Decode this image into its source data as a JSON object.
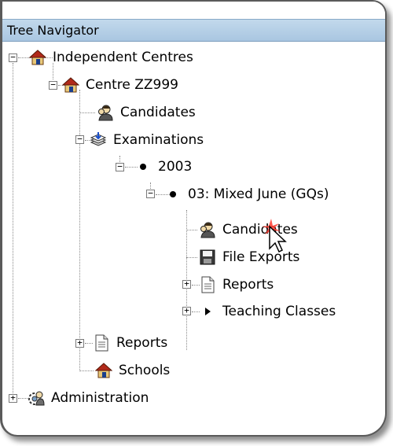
{
  "panel": {
    "title": "Tree Navigator"
  },
  "tree": {
    "independent_centres": "Independent Centres",
    "centre": "Centre ZZ999",
    "candidates": "Candidates",
    "examinations": "Examinations",
    "year": "2003",
    "series": "03: Mixed June (GQs)",
    "series_candidates": "Candidates",
    "file_exports": "File Exports",
    "series_reports": "Reports",
    "teaching_classes": "Teaching Classes",
    "centre_reports": "Reports",
    "schools": "Schools",
    "administration": "Administration"
  },
  "colors": {
    "title_bar": "#b4cfe6",
    "house_roof": "#b22a1a",
    "house_wall": "#e8c878"
  },
  "icons": {
    "independent_centres": "house-icon",
    "centre": "house-icon",
    "candidates": "people-icon",
    "examinations": "stack-icon",
    "year": "bullet-icon",
    "series": "bullet-icon",
    "file_exports": "floppy-disk-icon",
    "reports": "document-icon",
    "teaching_classes": "triangle-icon",
    "schools": "house-icon",
    "administration": "admin-icon",
    "pointer": "mouse-cursor-icon"
  }
}
